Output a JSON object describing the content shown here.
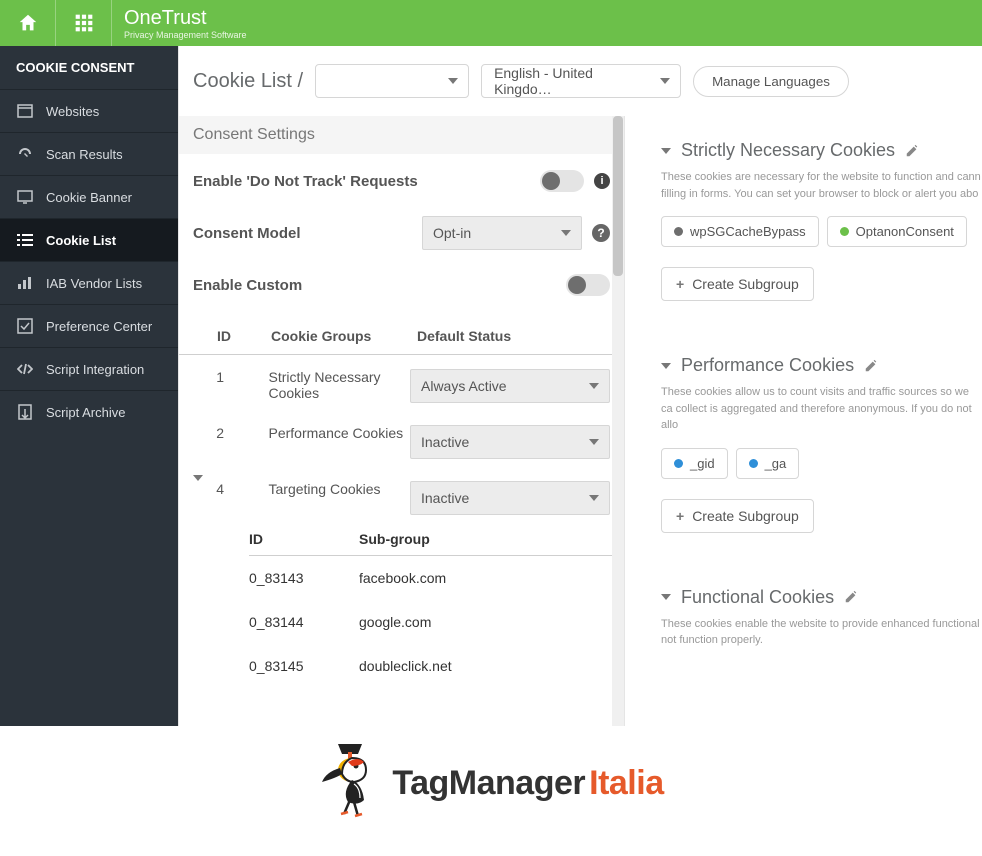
{
  "brand": {
    "name": "OneTrust",
    "tagline": "Privacy Management Software"
  },
  "sidebar": {
    "heading": "COOKIE CONSENT",
    "items": [
      {
        "label": "Websites"
      },
      {
        "label": "Scan Results"
      },
      {
        "label": "Cookie Banner"
      },
      {
        "label": "Cookie List"
      },
      {
        "label": "IAB Vendor Lists"
      },
      {
        "label": "Preference Center"
      },
      {
        "label": "Script Integration"
      },
      {
        "label": "Script Archive"
      }
    ]
  },
  "toolbar": {
    "crumb": "Cookie List /",
    "siteSelect": "",
    "langSelect": "English - United Kingdo…",
    "manageLang": "Manage Languages"
  },
  "settings": {
    "heading": "Consent Settings",
    "dnt_label": "Enable 'Do Not Track' Requests",
    "model_label": "Consent Model",
    "model_value": "Opt-in",
    "custom_label": "Enable Custom"
  },
  "groupsTable": {
    "headers": {
      "id": "ID",
      "groups": "Cookie Groups",
      "status": "Default Status"
    },
    "rows": [
      {
        "id": "1",
        "name": "Strictly Necessary Cookies",
        "status": "Always Active"
      },
      {
        "id": "2",
        "name": "Performance Cookies",
        "status": "Inactive"
      },
      {
        "id": "4",
        "name": "Targeting Cookies",
        "status": "Inactive"
      }
    ],
    "subHeaders": {
      "id": "ID",
      "name": "Sub-group"
    },
    "subRows": [
      {
        "id": "0_83143",
        "name": "facebook.com"
      },
      {
        "id": "0_83144",
        "name": "google.com"
      },
      {
        "id": "0_83145",
        "name": "doubleclick.net"
      }
    ]
  },
  "right": {
    "createSub": "Create Subgroup",
    "cats": [
      {
        "title": "Strictly Necessary Cookies",
        "desc": "These cookies are necessary for the website to function and cann filling in forms. You can set your browser to block or alert you abo",
        "chips": [
          {
            "label": "wpSGCacheBypass",
            "color": "gray"
          },
          {
            "label": "OptanonConsent",
            "color": "green"
          }
        ]
      },
      {
        "title": "Performance Cookies",
        "desc": "These cookies allow us to count visits and traffic sources so we ca collect is aggregated and therefore anonymous. If you do not allo",
        "chips": [
          {
            "label": "_gid",
            "color": "blue"
          },
          {
            "label": "_ga",
            "color": "blue"
          }
        ]
      },
      {
        "title": "Functional Cookies",
        "desc": "These cookies enable the website to provide enhanced functional not function properly.",
        "chips": []
      }
    ]
  },
  "footer": {
    "t1": "TagManager",
    "t2": "Italia"
  }
}
